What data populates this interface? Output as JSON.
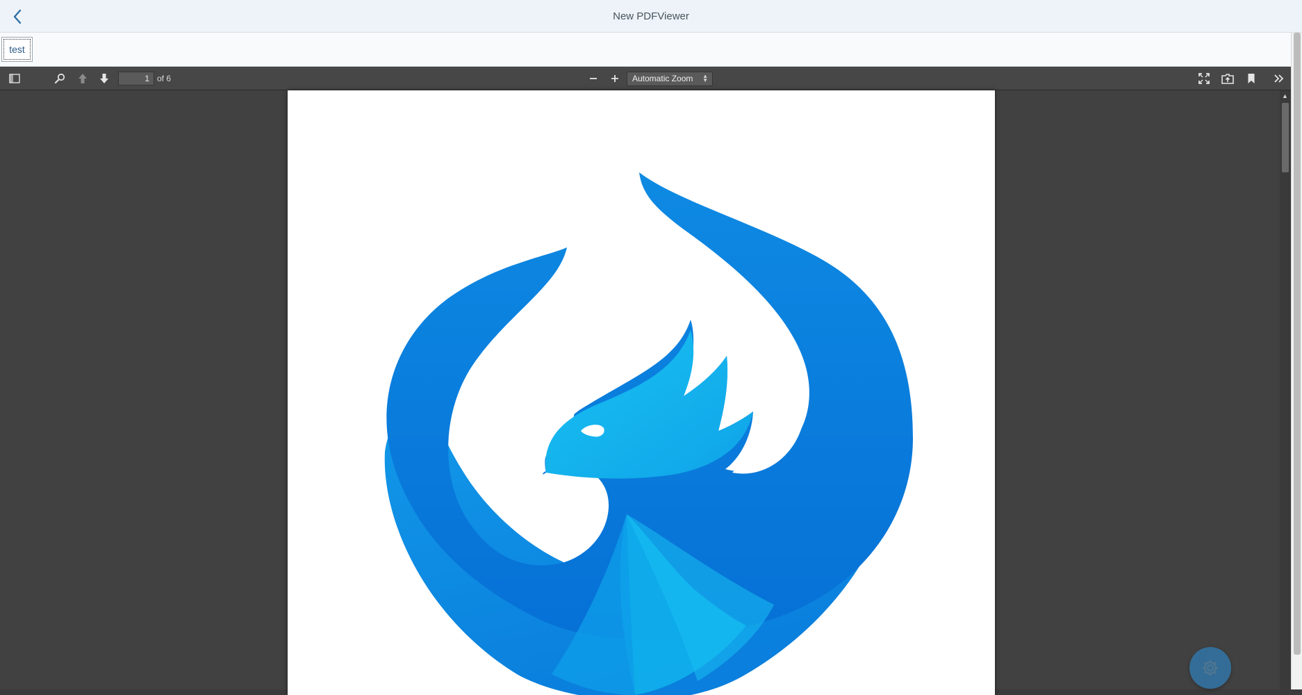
{
  "shell": {
    "title": "New PDFViewer",
    "back_icon": "chevron-left-icon"
  },
  "subheader": {
    "tab_label": "test"
  },
  "viewer": {
    "toolbar": {
      "sidebar_toggle_icon": "sidebar-toggle-icon",
      "search_icon": "search-icon",
      "prev_page_icon": "arrow-up-icon",
      "next_page_icon": "arrow-down-icon",
      "page_number": "1",
      "page_count": "of 6",
      "zoom_out_icon": "minus-icon",
      "zoom_in_icon": "plus-icon",
      "zoom_value": "Automatic Zoom",
      "presentation_icon": "fullscreen-icon",
      "open_file_icon": "open-file-icon",
      "bookmark_icon": "bookmark-icon",
      "tools_icon": "double-chevron-right-icon"
    },
    "page": {
      "logo": "phoenix-bird-logo"
    },
    "colors": {
      "toolbar": "#474747",
      "canvas": "#404040",
      "logo_primary": "#0f8fe6",
      "logo_light": "#10b6ee",
      "logo_dark": "#0874d6"
    }
  },
  "settings_fab": {
    "icon": "gear-icon"
  }
}
